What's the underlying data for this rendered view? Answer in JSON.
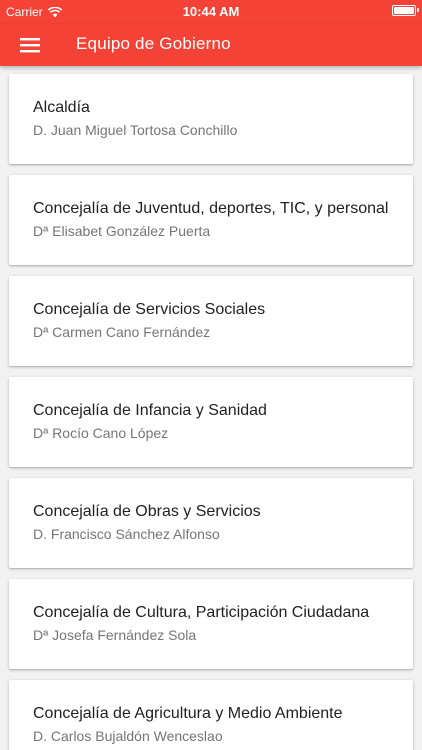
{
  "status_bar": {
    "carrier": "Carrier",
    "time": "10:44 AM",
    "battery_level": 1.0
  },
  "toolbar": {
    "title": "Equipo de Gobierno",
    "menu_icon": "hamburger-menu-icon"
  },
  "colors": {
    "primary": "#f44336",
    "background": "#f2f2f2",
    "card": "#ffffff",
    "primary_text": "#212121",
    "secondary_text": "#757575"
  },
  "list": {
    "items": [
      {
        "title": "Alcaldía",
        "person": "D. Juan Miguel Tortosa Conchillo"
      },
      {
        "title": "Concejalía de Juventud, deportes, TIC, y personal",
        "person": "Dª Elisabet González Puerta"
      },
      {
        "title": "Concejalía de Servicios Sociales",
        "person": "Dª Carmen Cano Fernández"
      },
      {
        "title": "Concejalía de Infancia y Sanidad",
        "person": "Dª Rocío Cano López"
      },
      {
        "title": "Concejalía de Obras y Servicios",
        "person": "D. Francisco Sánchez Alfonso"
      },
      {
        "title": "Concejalía de Cultura, Participación Ciudadana",
        "person": "Dª Josefa Fernández Sola"
      },
      {
        "title": "Concejalía de Agricultura y Medio Ambiente",
        "person": "D. Carlos Bujaldón Wenceslao"
      }
    ]
  }
}
